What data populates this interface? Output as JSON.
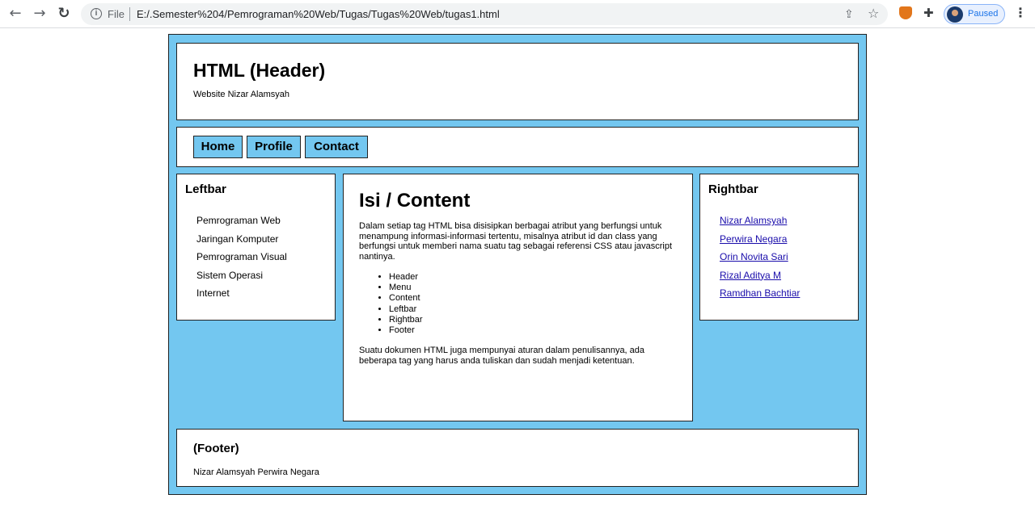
{
  "browser": {
    "url_scheme_label": "File",
    "url": "E:/.Semester%204/Pemrograman%20Web/Tugas/Tugas%20Web/tugas1.html",
    "profile_status": "Paused",
    "icons": [
      "back-icon",
      "forward-icon",
      "reload-icon",
      "info-icon",
      "share-icon",
      "star-icon",
      "metamask-extension-icon",
      "puzzle-extensions-icon",
      "avatar",
      "menu-dots-icon"
    ]
  },
  "header": {
    "title": "HTML (Header)",
    "subtitle": "Website Nizar Alamsyah"
  },
  "menu": {
    "items": [
      "Home",
      "Profile",
      "Contact"
    ]
  },
  "leftbar": {
    "title": "Leftbar",
    "items": [
      "Pemrograman Web",
      "Jaringan Komputer",
      "Pemrograman Visual",
      "Sistem Operasi",
      "Internet"
    ]
  },
  "content": {
    "title": "Isi / Content",
    "paragraph1": "Dalam setiap tag HTML bisa disisipkan berbagai atribut yang berfungsi untuk menampung informasi-informasi tertentu, misalnya atribut id dan class yang berfungsi untuk memberi nama suatu tag sebagai referensi CSS atau javascript nantinya.",
    "list": [
      "Header",
      "Menu",
      "Content",
      "Leftbar",
      "Rightbar",
      "Footer"
    ],
    "paragraph2": "Suatu dokumen HTML juga mempunyai aturan dalam penulisannya, ada beberapa tag yang harus anda tuliskan dan sudah menjadi ketentuan."
  },
  "rightbar": {
    "title": "Rightbar",
    "links": [
      "Nizar Alamsyah",
      "Perwira Negara",
      "Orin Novita Sari",
      "Rizal Aditya M",
      "Ramdhan Bachtiar"
    ]
  },
  "footer": {
    "title": "(Footer)",
    "text": "Nizar Alamsyah Perwira Negara"
  },
  "colors": {
    "page_background": "#73c7f0",
    "box_background": "#ffffff",
    "border": "#222222",
    "link": "#1a0dab"
  }
}
